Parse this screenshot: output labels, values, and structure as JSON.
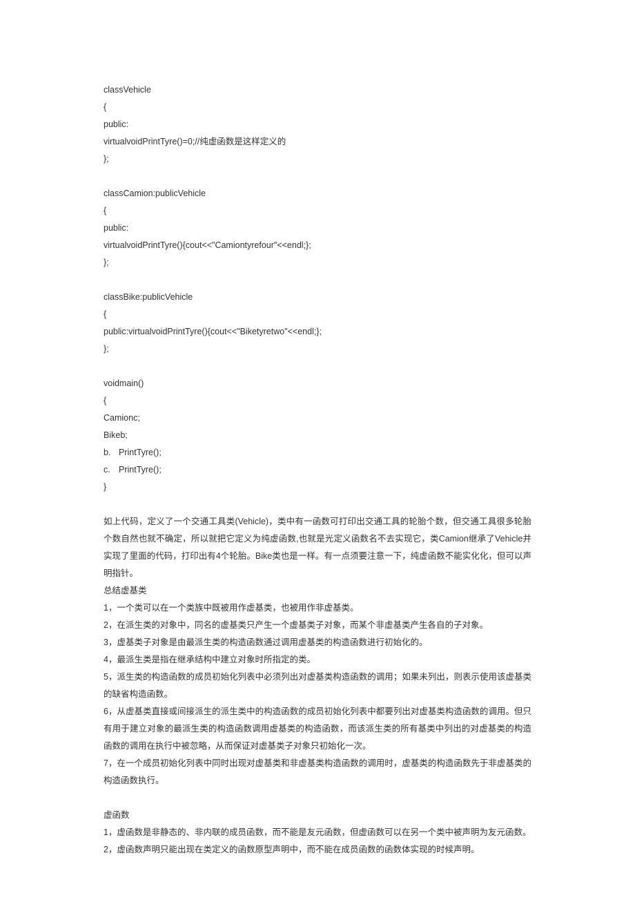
{
  "code": {
    "l1": "classVehicle",
    "l2": "{",
    "l3": "public:",
    "l4": "virtualvoidPrintTyre()=0;//纯虚函数是这样定义的",
    "l5": "};",
    "l6": "classCamion:publicVehicle",
    "l7": "{",
    "l8": "public:",
    "l9": "virtualvoidPrintTyre(){cout<<\"Camiontyrefour\"<<endl;};",
    "l10": "};",
    "l11": "classBike:publicVehicle",
    "l12": "{",
    "l13": "public:virtualvoidPrintTyre(){cout<<\"Biketyretwo\"<<endl;};",
    "l14": "};",
    "l15": "voidmain()",
    "l16": "{",
    "l17": "Camionc;",
    "l18": "Bikeb;",
    "l19a": "b.",
    "l19b": "PrintTyre();",
    "l20a": "c.",
    "l20b": "PrintTyre();",
    "l21": "}"
  },
  "para1": "如上代码，定义了一个交通工具类(Vehicle)，类中有一函数可打印出交通工具的轮胎个数，但交通工具很多轮胎个数自然也就不确定，所以就把它定义为纯虚函数,也就是光定义函数名不去实现它，类Camion继承了Vehicle并实现了里面的代码，打印出有4个轮胎。Bike类也是一样。有一点须要注意一下，纯虚函数不能实化化，但可以声明指针。",
  "section1_title": "总结虚基类",
  "section1": {
    "i1": "1，一个类可以在一个类族中既被用作虚基类，也被用作非虚基类。",
    "i2": "2，在派生类的对象中，同名的虚基类只产生一个虚基类子对象，而某个非虚基类产生各自的子对象。",
    "i3": "3，虚基类子对象是由最派生类的构造函数通过调用虚基类的构造函数进行初始化的。",
    "i4": "4，最派生类是指在继承结构中建立对象时所指定的类。",
    "i5": "5，派生类的构造函数的成员初始化列表中必须列出对虚基类构造函数的调用；如果未列出，则表示使用该虚基类的缺省构造函数。",
    "i6": "6，从虚基类直接或间接派生的派生类中的构造函数的成员初始化列表中都要列出对虚基类构造函数的调用。但只有用于建立对象的最派生类的构造函数调用虚基类的构造函数，而该派生类的所有基类中列出的对虚基类的构造函数的调用在执行中被忽略，从而保证对虚基类子对象只初始化一次。",
    "i7": "7，在一个成员初始化列表中同时出现对虚基类和非虚基类构造函数的调用时，虚基类的构造函数先于非虚基类的构造函数执行。"
  },
  "section2_title": "虚函数",
  "section2": {
    "i1": "1，虚函数是非静态的、非内联的成员函数，而不能是友元函数，但虚函数可以在另一个类中被声明为友元函数。",
    "i2": "2，虚函数声明只能出现在类定义的函数原型声明中，而不能在成员函数的函数体实现的时候声明。"
  }
}
